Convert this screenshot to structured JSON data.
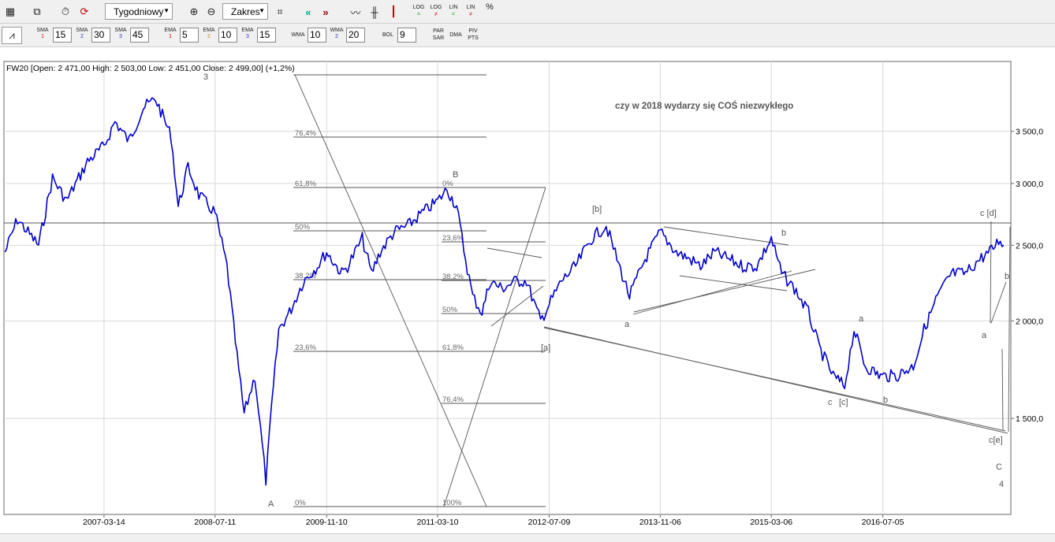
{
  "toolbar": {
    "interval": "Tygodniowy",
    "range": "Zakres",
    "log1": "LOG",
    "log2": "LOG",
    "lin1": "LIN",
    "lin2": "LIN",
    "pct": "%"
  },
  "indicators": {
    "sma": [
      {
        "label": "SMA",
        "n": "1",
        "value": "15"
      },
      {
        "label": "SMA",
        "n": "2",
        "value": "30"
      },
      {
        "label": "SMA",
        "n": "3",
        "value": "45"
      }
    ],
    "ema": [
      {
        "label": "EMA",
        "n": "1",
        "value": "5"
      },
      {
        "label": "EMA",
        "n": "2",
        "value": "10"
      },
      {
        "label": "EMA",
        "n": "3",
        "value": "15"
      }
    ],
    "wma": [
      {
        "label": "WMA",
        "value": "10"
      },
      {
        "label": "WMA",
        "n": "2",
        "value": "20"
      }
    ],
    "bol": {
      "label": "BOL",
      "value": "9"
    },
    "par": {
      "line1": "PAR",
      "line2": "SAR"
    },
    "dma": {
      "label": "DMA"
    },
    "piv": {
      "line1": "PIV",
      "line2": "PTS"
    }
  },
  "chart_data": {
    "type": "line",
    "header": "FW20 [Open: 2 471,00  High: 2 503,00  Low: 2 451,00  Close: 2 499,00] (+1,2%)",
    "annotation": "czy w 2018 wydarzy się COŚ niezwykłego",
    "x_tick_labels": [
      "2007-03-14",
      "2008-07-11",
      "2009-11-10",
      "2011-03-10",
      "2012-07-09",
      "2013-11-06",
      "2015-03-06",
      "2016-07-05"
    ],
    "y_tick_labels": [
      "3 500,0",
      "3 000,0",
      "2 500,0",
      "2 000,0",
      "1 500,0"
    ],
    "y_scale": "log",
    "xlim": [
      "2006-01-01",
      "2018-01-15"
    ],
    "ylim": [
      1130,
      4300
    ],
    "series_color": "#0000cc",
    "series": [
      {
        "x": [
          "2006-01-06",
          "2006-03-01",
          "2006-06-01",
          "2006-08-01",
          "2006-10-01",
          "2007-01-01",
          "2007-03-14",
          "2007-05-01",
          "2007-07-01",
          "2007-09-01",
          "2007-10-25",
          "2008-01-01",
          "2008-02-01",
          "2008-03-15",
          "2008-05-01",
          "2008-07-11",
          "2008-09-01",
          "2008-10-15",
          "2008-11-15",
          "2009-01-01",
          "2009-02-18",
          "2009-03-15",
          "2009-04-15",
          "2009-06-01",
          "2009-08-01",
          "2009-10-01",
          "2009-11-10",
          "2010-01-15",
          "2010-02-10",
          "2010-04-15",
          "2010-05-25",
          "2010-07-01",
          "2010-09-01",
          "2010-11-01",
          "2011-01-01",
          "2011-03-10",
          "2011-04-20",
          "2011-06-01",
          "2011-07-10",
          "2011-08-10",
          "2011-09-20",
          "2011-10-25",
          "2011-12-15",
          "2012-02-15",
          "2012-04-01",
          "2012-06-01",
          "2012-07-09",
          "2012-09-01",
          "2012-11-01",
          "2013-01-10",
          "2013-03-15",
          "2013-05-01",
          "2013-06-25",
          "2013-09-01",
          "2013-11-06",
          "2014-01-15",
          "2014-03-15",
          "2014-05-01",
          "2014-07-01",
          "2014-09-01",
          "2014-11-01",
          "2015-01-01",
          "2015-03-06",
          "2015-04-20",
          "2015-06-15",
          "2015-08-15",
          "2015-10-01",
          "2015-12-01",
          "2016-01-20",
          "2016-03-01",
          "2016-04-20",
          "2016-06-25",
          "2016-09-01",
          "2016-11-15",
          "2017-01-01",
          "2017-03-01",
          "2017-05-01",
          "2017-07-01",
          "2017-09-01",
          "2017-10-15",
          "2017-11-30",
          "2017-12-15"
        ],
        "y": [
          2450,
          2700,
          2500,
          3050,
          2850,
          3200,
          3350,
          3600,
          3400,
          3750,
          3850,
          3450,
          2800,
          3150,
          2900,
          2750,
          2350,
          1800,
          1520,
          1700,
          1250,
          1550,
          1950,
          2050,
          2250,
          2350,
          2450,
          2300,
          2350,
          2550,
          2300,
          2450,
          2600,
          2650,
          2750,
          2850,
          2950,
          2800,
          2400,
          2150,
          2050,
          2250,
          2200,
          2250,
          2250,
          2000,
          2100,
          2250,
          2350,
          2550,
          2650,
          2400,
          2150,
          2400,
          2600,
          2450,
          2400,
          2350,
          2450,
          2400,
          2350,
          2350,
          2550,
          2300,
          2200,
          2050,
          1850,
          1700,
          1650,
          1950,
          1750,
          1700,
          1700,
          1750,
          1950,
          2150,
          2300,
          2300,
          2400,
          2450,
          2550,
          2500
        ]
      }
    ],
    "fibonacci": [
      {
        "side": "left",
        "labels": [
          "76,4%",
          "61,8%",
          "50%",
          "38,2%",
          "23,6%",
          "0%"
        ]
      },
      {
        "side": "right",
        "labels": [
          "0%",
          "23,6%",
          "38,2%",
          "50%",
          "61,8%",
          "76,4%",
          "100%"
        ]
      }
    ],
    "wave_labels": [
      "3",
      "A",
      "B",
      "[a]",
      "[b]",
      "a",
      "b",
      "c",
      "[c]",
      "a",
      "b",
      "c [d]",
      "a",
      "b",
      "c[e]",
      "C",
      "4"
    ]
  }
}
